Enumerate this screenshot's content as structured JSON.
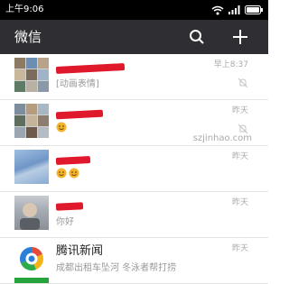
{
  "status_bar": {
    "time": "上午9:06"
  },
  "header": {
    "title": "微信",
    "search_icon": "search-icon",
    "add_icon": "plus-icon"
  },
  "chats": [
    {
      "time": "早上8:37",
      "preview": "[动画表情]",
      "muted": true,
      "avatar": "group-avatar-grid"
    },
    {
      "time": "昨天",
      "preview": "",
      "muted": true,
      "avatar": "group-avatar-grid"
    },
    {
      "time": "昨天",
      "preview": "",
      "muted": false,
      "avatar": "sky-photo"
    },
    {
      "time": "昨天",
      "preview": "你好",
      "muted": false,
      "avatar": "person-photo"
    },
    {
      "name": "腾讯新闻",
      "time": "昨天",
      "preview": "成都出租车坠河 冬泳者帮打捞",
      "muted": false,
      "avatar": "tencent-news-logo"
    }
  ],
  "watermark": "szjinhao.com",
  "colors": {
    "status_bar": "#000000",
    "app_bar": "#2f2f33",
    "redaction": "#e0182b",
    "emoji": "#f3b32b"
  }
}
